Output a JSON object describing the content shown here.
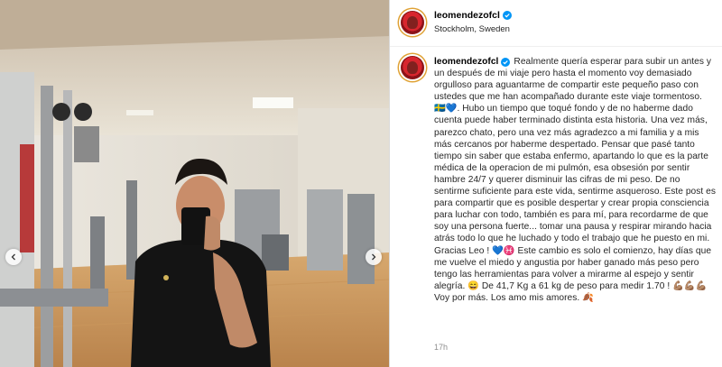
{
  "post": {
    "username": "leomendezofcl",
    "location": "Stockholm, Sweden",
    "caption": "Realmente quería esperar para subir un antes y un después de mi viaje pero hasta el momento voy demasiado orgulloso para aguantarme de compartir este pequeño paso con ustedes que me han acompañado durante este viaje tormentoso. 🇸🇪💙. Hubo un tiempo que toqué fondo y de no haberme dado cuenta puede haber terminado distinta esta historia. Una vez más, parezco chato, pero una vez más agradezco a mi familia y a mis más cercanos por haberme despertado. Pensar que pasé tanto tiempo sin saber que estaba enfermo, apartando lo que es la parte médica de la operacion de mi pulmón, esa obsesión por sentir hambre 24/7 y querer disminuir las cifras de mi peso. De no sentirme suficiente para este vida, sentirme asqueroso. Este post es para compartir que es posible despertar y crear propia consciencia para luchar con todo, también es para mí, para recordarme de que soy una persona fuerte... tomar una pausa y respirar mirando hacia atrás todo lo que he luchado y todo el trabajo que he puesto en mi. Gracias Leo ! 💙♓ Este cambio es solo el comienzo, hay días que me vuelve el miedo y angustia por haber ganado más peso pero tengo las herramientas para volver a mirarme al espejo y sentir alegría. 😄 De 41,7 Kg a 61 kg de peso para medir 1.70 ! 💪🏽💪🏽💪🏽 Voy por más. Los amo mis amores. 🍂",
    "timestamp": "17h"
  },
  "icons": {
    "verified": "verified-badge-icon",
    "prev": "chevron-left-icon",
    "next": "chevron-right-icon"
  },
  "colors": {
    "verified": "#0095f6",
    "avatar_ring": "#e0a236",
    "avatar_fill": "#d8262e"
  }
}
